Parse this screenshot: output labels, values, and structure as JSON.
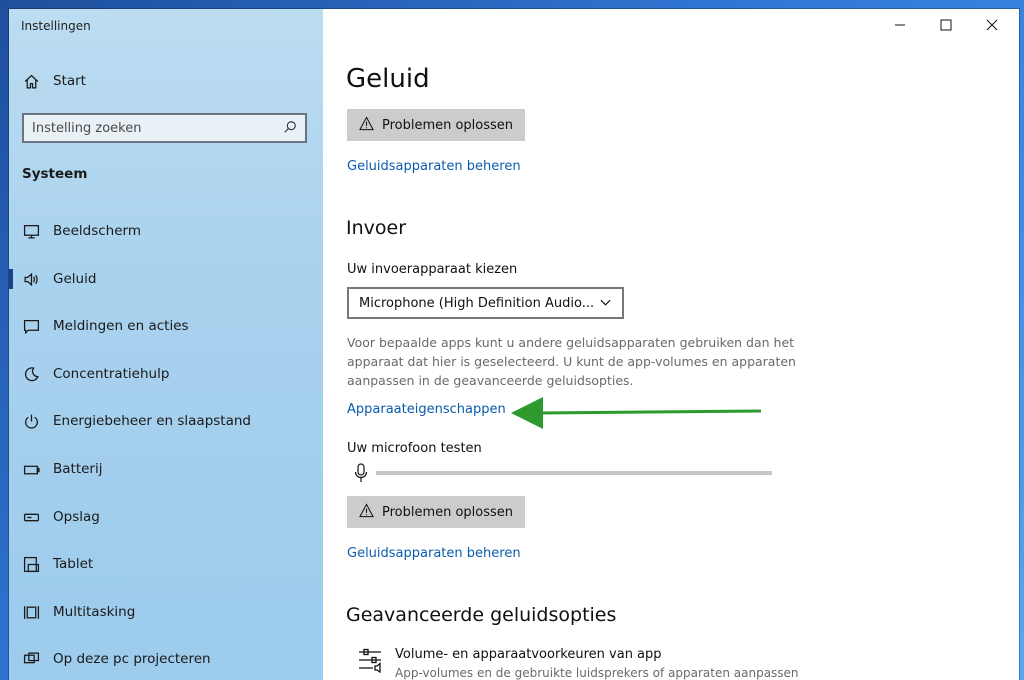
{
  "window": {
    "title": "Instellingen"
  },
  "sidebar": {
    "home_label": "Start",
    "search_placeholder": "Instelling zoeken",
    "section_title": "Systeem",
    "items": [
      {
        "label": "Beeldscherm",
        "icon": "monitor-icon"
      },
      {
        "label": "Geluid",
        "icon": "speaker-icon",
        "selected": true
      },
      {
        "label": "Meldingen en acties",
        "icon": "notification-icon"
      },
      {
        "label": "Concentratiehulp",
        "icon": "moon-icon"
      },
      {
        "label": "Energiebeheer en slaapstand",
        "icon": "power-icon"
      },
      {
        "label": "Batterij",
        "icon": "battery-icon"
      },
      {
        "label": "Opslag",
        "icon": "storage-icon"
      },
      {
        "label": "Tablet",
        "icon": "tablet-icon"
      },
      {
        "label": "Multitasking",
        "icon": "multitasking-icon"
      },
      {
        "label": "Op deze pc projecteren",
        "icon": "project-icon"
      }
    ]
  },
  "main": {
    "title": "Geluid",
    "troubleshoot_label": "Problemen oplossen",
    "manage_devices_link": "Geluidsapparaten beheren",
    "input": {
      "heading": "Invoer",
      "choose_label": "Uw invoerapparaat kiezen",
      "selected_device": "Microphone (High Definition Audio...",
      "description": "Voor bepaalde apps kunt u andere geluidsapparaten gebruiken dan het apparaat dat hier is geselecteerd. U kunt de app-volumes en apparaten aanpassen in de geavanceerde geluidsopties.",
      "device_properties_link": "Apparaateigenschappen",
      "test_label": "Uw microfoon testen",
      "mic_level": 0,
      "troubleshoot_label": "Problemen oplossen",
      "manage_devices_link": "Geluidsapparaten beheren"
    },
    "advanced": {
      "heading": "Geavanceerde geluidsopties",
      "item_title": "Volume- en apparaatvoorkeuren van app",
      "item_desc": "App-volumes en de gebruikte luidsprekers of apparaten aanpassen"
    }
  },
  "colors": {
    "link": "#0b5cad",
    "sidebar_bg": "#a9d2ee",
    "button_bg": "#cccccc",
    "annotation_arrow": "#2e9a2e"
  }
}
